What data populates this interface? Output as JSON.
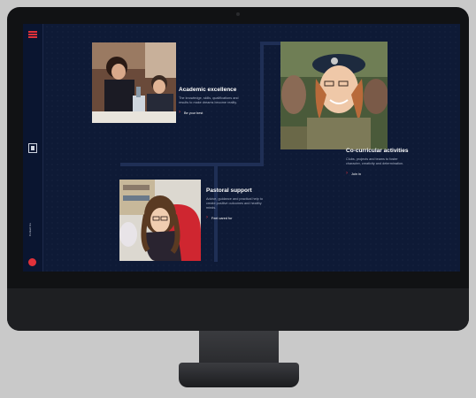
{
  "sidebar": {
    "menu_icon": "hamburger-icon",
    "crest_icon": "school-crest-icon",
    "vertical_label": "Contact Us"
  },
  "cards": [
    {
      "title": "Academic excellence",
      "text": "The knowledge, skills, qualifications and results to make dreams become reality.",
      "cta": "Be your best"
    },
    {
      "title": "Co-curricular activities",
      "text": "Clubs, projects and teams to foster character, creativity and determination.",
      "cta": "Join in"
    },
    {
      "title": "Pastoral support",
      "text": "Advice, guidance and practical help to create positive outcomes and healthy minds.",
      "cta": "Feel cared for"
    }
  ],
  "colors": {
    "background": "#0e1a36",
    "accent": "#e0313a"
  }
}
